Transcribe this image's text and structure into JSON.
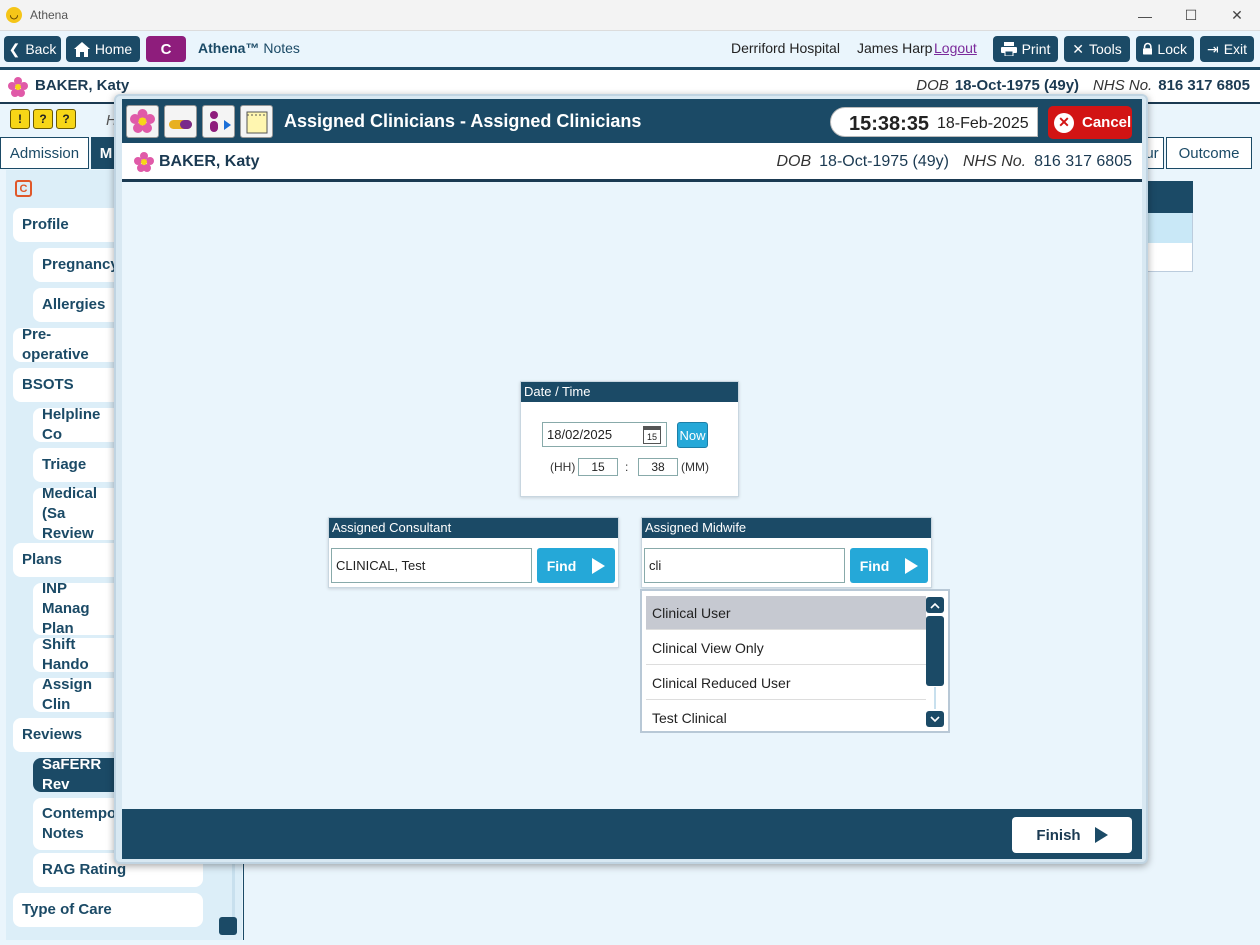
{
  "os": {
    "title": "Athena",
    "controls": [
      "minimize",
      "maximize",
      "close"
    ]
  },
  "topbar": {
    "back": "Back",
    "home": "Home",
    "c_label": "C",
    "app_brand": "Athena™",
    "app_suffix": "Notes",
    "hospital": "Derriford Hospital",
    "user": "James Harp",
    "logout": "Logout",
    "print": "Print",
    "tools": "Tools",
    "lock": "Lock",
    "exit": "Exit"
  },
  "patient": {
    "name": "BAKER, Katy",
    "dob_label": "DOB",
    "dob": "18-Oct-1975 (49y)",
    "nhs_label": "NHS No.",
    "nhs": "816 317 6805"
  },
  "icon_strip": [
    "!",
    "?",
    "?"
  ],
  "bg_tabs": {
    "admission": "Admission",
    "m_partial": "M",
    "ur_partial": "ur",
    "outcome": "Outcome"
  },
  "bg_h": "H",
  "nav": {
    "items": [
      "Profile",
      "Pregnancy",
      "Allergies",
      "Pre-operative",
      "BSOTS",
      "Helpline Co",
      "Triage",
      "Medical (Sa",
      "Review",
      "Plans",
      "INP Manag",
      "Plan",
      "Shift Hando",
      "Assign Clin",
      "Reviews",
      "SaFERR Rev",
      "Contempor",
      "Notes",
      "RAG Rating",
      "Type of Care"
    ]
  },
  "modal": {
    "title": "Assigned Clinicians - Assigned Clinicians",
    "time": "15:38:35",
    "date": "18-Feb-2025",
    "cancel": "Cancel",
    "finish": "Finish",
    "datetime_panel": {
      "title": "Date / Time",
      "date_value": "18/02/2025",
      "cal_day": "15",
      "now": "Now",
      "hh_label": "(HH)",
      "hh_value": "15",
      "colon": ":",
      "mm_value": "38",
      "mm_label": "(MM)"
    },
    "consultant": {
      "title": "Assigned Consultant",
      "value": "CLINICAL, Test",
      "find": "Find"
    },
    "midwife": {
      "title": "Assigned Midwife",
      "value": "cli",
      "find": "Find"
    },
    "dropdown": {
      "options": [
        "Clinical User",
        "Clinical View Only",
        "Clinical Reduced User",
        "Test Clinical"
      ],
      "selected": "Clinical User"
    }
  },
  "colors": {
    "navy": "#1b4a66",
    "accent": "#25a8d8",
    "cancel": "#d21414",
    "c_purple": "#8e1d7c"
  }
}
